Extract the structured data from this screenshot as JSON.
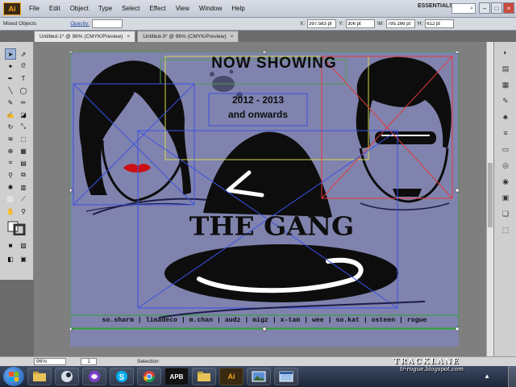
{
  "app": {
    "logo": "Ai",
    "menu": [
      "File",
      "Edit",
      "Object",
      "Type",
      "Select",
      "Effect",
      "View",
      "Window",
      "Help"
    ],
    "workspace": "ESSENTIALS",
    "search_placeholder": "⌕"
  },
  "control_bar": {
    "selection_type": "Mixed Objects",
    "opacity_label": "Opacity:",
    "x_label": "X:",
    "x_value": "397.583 pt",
    "y_label": "Y:",
    "y_value": "306 pt",
    "w_label": "W:",
    "w_value": "795.166 pt",
    "h_label": "H:",
    "h_value": "612 pt"
  },
  "tabs": [
    {
      "label": "Untitled-1* @ 96% (CMYK/Preview)",
      "close": "×"
    },
    {
      "label": "Untitled-3* @ 96% (CMYK/Preview)",
      "close": "×"
    }
  ],
  "artwork": {
    "heading": "NOW SHOWING",
    "years": "2012 - 2013",
    "onwards": "and onwards",
    "title": "THE GANG",
    "credits": "so.sharm | limadeco | m.chan | audz | migz | x-tam | wee | so.kat | osteen | rogue"
  },
  "status_bar": {
    "zoom": "96%",
    "page": "1",
    "status": "Selection"
  },
  "taskbar": {
    "apps": [
      "explorer-icon",
      "steam-icon",
      "media-icon",
      "skype-icon",
      "chrome-icon",
      "apb-icon",
      "folder-icon",
      "illustrator-icon",
      "photos-icon",
      "window-icon"
    ],
    "apb_label": "APB",
    "ai_label": "Ai"
  },
  "watermark": {
    "line1": "TRACKLANE",
    "line2": "tr-rogue.blogspot.com"
  },
  "colors": {
    "artboard": "#8083ad",
    "lips": "#cc0f14",
    "ai_orange": "#f7a41c"
  }
}
